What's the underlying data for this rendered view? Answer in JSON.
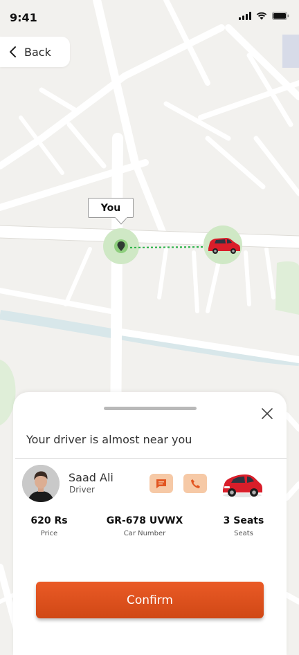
{
  "status_bar": {
    "time": "9:41"
  },
  "header": {
    "back_label": "Back"
  },
  "map": {
    "you_label": "You",
    "accent_color": "#2db34a"
  },
  "sheet": {
    "title": "Your driver is almost near you",
    "driver": {
      "name": "Saad Ali",
      "role": "Driver"
    },
    "actions": [
      {
        "name": "message",
        "icon": "chat-icon"
      },
      {
        "name": "call",
        "icon": "phone-icon"
      }
    ],
    "info": {
      "price_value": "620 Rs",
      "price_label": "Price",
      "car_number_value": "GR-678 UVWX",
      "car_number_label": "Car Number",
      "seats_value": "3 Seats",
      "seats_label": "Seats"
    },
    "confirm_label": "Confirm"
  },
  "colors": {
    "accent": "#e25520",
    "action_bg": "#f6c9a6",
    "car": "#d91e2a"
  }
}
